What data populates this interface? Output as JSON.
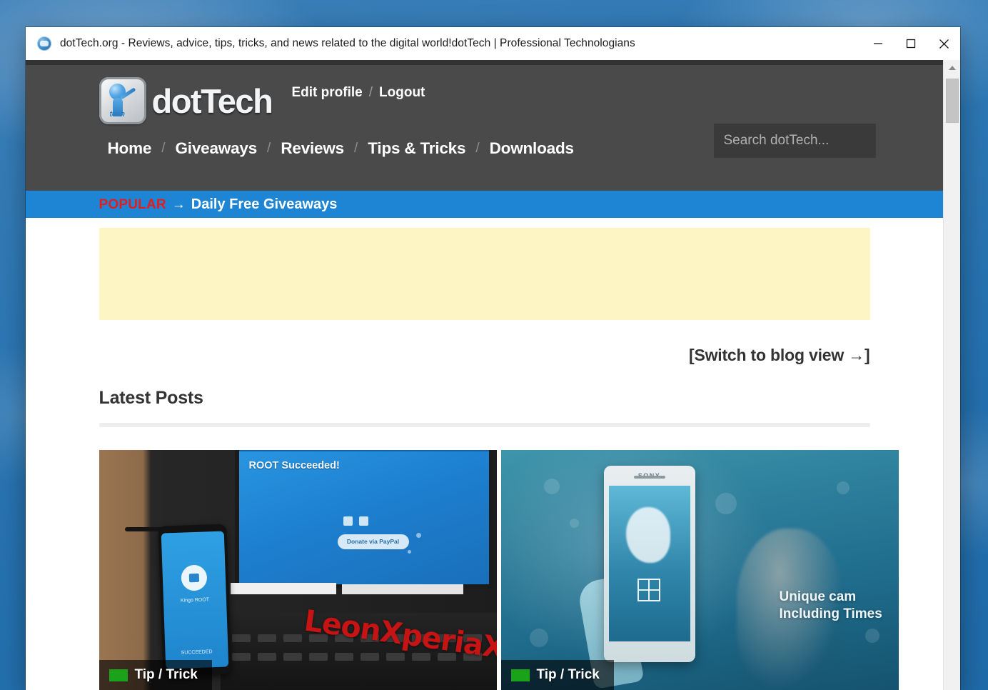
{
  "window": {
    "title": "dotTech.org - Reviews, advice, tips, tricks, and news related to the digital world!dotTech | Professional Technologians",
    "controls": {
      "minimize": "minimize-button",
      "maximize": "maximize-button",
      "close": "close-button"
    }
  },
  "site": {
    "logo_word": "dotTech",
    "logo_mark_text": "tech",
    "account": {
      "edit_profile": "Edit profile",
      "separator": "/",
      "logout": "Logout"
    },
    "nav": [
      {
        "label": "Home"
      },
      {
        "label": "Giveaways"
      },
      {
        "label": "Reviews"
      },
      {
        "label": "Tips & Tricks"
      },
      {
        "label": "Downloads"
      }
    ],
    "nav_separator": "/",
    "search": {
      "value": "",
      "placeholder": "Search dotTech..."
    },
    "popular": {
      "label": "POPULAR",
      "arrow": "→",
      "link": "Daily Free Giveaways"
    }
  },
  "main": {
    "blog_view_link": "[Switch to blog view →]",
    "latest_posts_heading": "Latest Posts",
    "cards": [
      {
        "category": "Tip / Trick",
        "image_texts": {
          "screen_heading": "ROOT Succeeded!",
          "screen_button": "Donate via PayPal",
          "phone_caption": "Kingo ROOT",
          "phone_caption2": "SUCCEEDED",
          "watermark": "LeonXperiaXC"
        }
      },
      {
        "category": "Tip / Trick",
        "image_texts": {
          "phone_brand": "SONY",
          "overlay_line1": "Unique cam",
          "overlay_line2": "Including Times"
        }
      }
    ]
  },
  "colors": {
    "header_bg": "#4a4a4a",
    "header_top_strip": "#333333",
    "popular_bar": "#1e85d5",
    "popular_label": "#e81b1b",
    "ad_slot": "#fdf5c4",
    "badge_green": "#1aa31a",
    "desktop": "#2c77b4"
  }
}
